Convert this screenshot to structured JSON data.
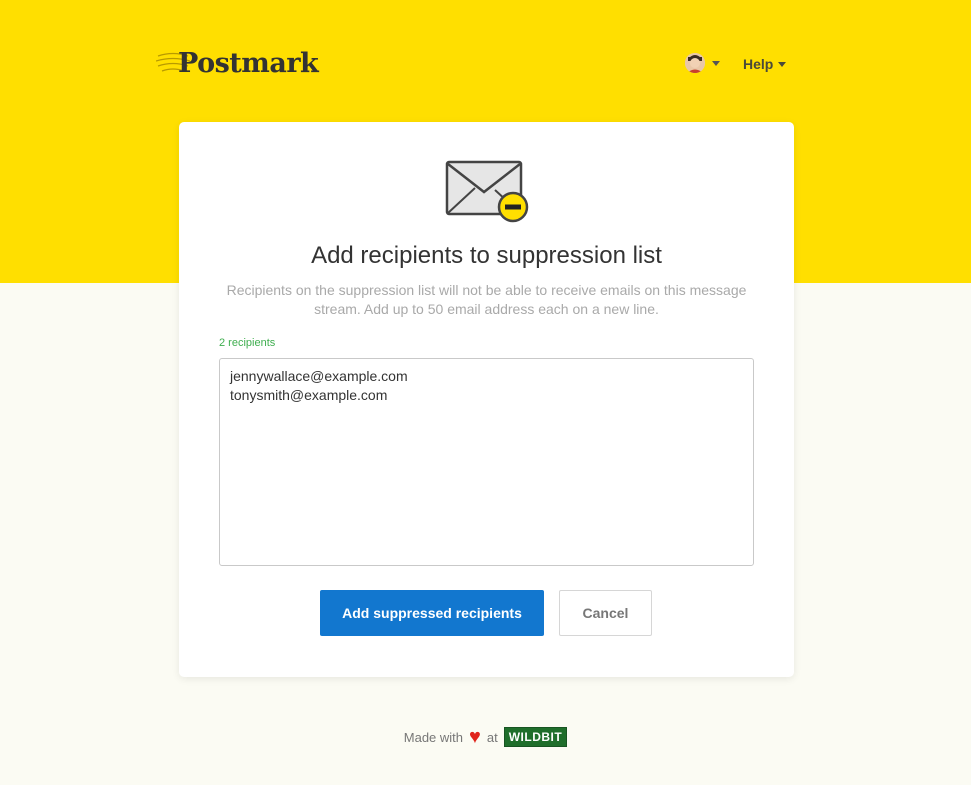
{
  "header": {
    "logo_text": "Postmark",
    "account_menu": {
      "avatar_icon": "user-avatar"
    },
    "help_label": "Help"
  },
  "card": {
    "icon": "envelope-minus-icon",
    "title": "Add recipients to suppression list",
    "description": "Recipients on the suppression list will not be able to receive emails on this message stream. Add up to 50 email address each on a new line.",
    "recipient_count_label": "2 recipients",
    "recipients_value": "jennywallace@example.com\ntonysmith@example.com",
    "primary_button_label": "Add suppressed recipients",
    "cancel_button_label": "Cancel"
  },
  "footer": {
    "made_with": "Made with",
    "heart": "♥",
    "at": "at",
    "company": "WILDBIT"
  },
  "colors": {
    "brand_yellow": "#ffdf00",
    "primary_blue": "#1277cf",
    "count_green": "#3fae4f",
    "heart_red": "#e0241b",
    "wildbit_green": "#1f6e2b"
  }
}
